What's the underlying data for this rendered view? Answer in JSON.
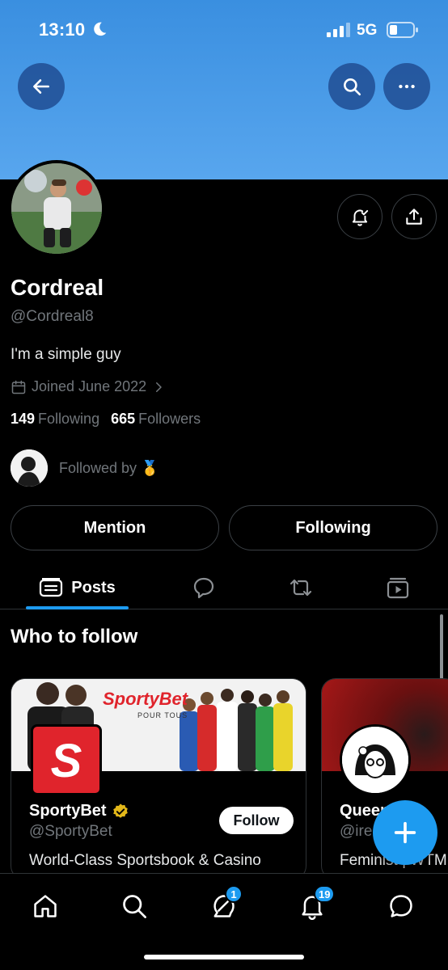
{
  "status_bar": {
    "time": "13:10",
    "network": "5G"
  },
  "profile": {
    "name": "Cordreal",
    "handle": "@Cordreal8",
    "bio": "I'm a simple guy",
    "joined": "Joined June 2022",
    "following_count": "149",
    "following_label": "Following",
    "followers_count": "665",
    "followers_label": "Followers",
    "followed_by": "Followed by 🥇"
  },
  "actions": {
    "mention": "Mention",
    "following": "Following"
  },
  "tabs": [
    {
      "label": "Posts",
      "active": true
    }
  ],
  "who_to_follow": {
    "title": "Who to follow",
    "cards": [
      {
        "banner_brand": "SportyBet",
        "banner_tagline": "POUR TOUS",
        "name": "SportyBet",
        "handle": "@SportyBet",
        "bio": "World-Class Sportsbook & Casino",
        "button": "Follow"
      },
      {
        "name": "Queen",
        "name_tail": "Que",
        "handle": "@ire",
        "bio": "Feminist | WTM"
      }
    ]
  },
  "bottom_nav": {
    "messages_badge": "1",
    "notifications_badge": "19"
  },
  "colors": {
    "accent": "#1d9bf0",
    "banner": "#4a9be8",
    "verified": "#e2b719"
  }
}
